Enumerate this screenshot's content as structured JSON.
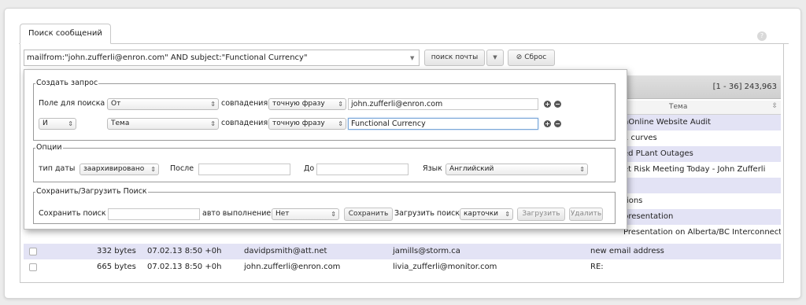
{
  "tab": {
    "label": "Поиск сообщений"
  },
  "search": {
    "query": "mailfrom:\"john.zufferli@enron.com\" AND subject:\"Functional Currency\"",
    "search_label": "поиск почты",
    "reset_label": "Сброс"
  },
  "results": {
    "count": "[1 - 36] 243,963",
    "subject_header": "Тема",
    "subjects_partial": [
      "nOnline Website Audit",
      "1 curves",
      "ed PLant Outages",
      "et Risk Meeting Today - John Zufferli",
      "",
      "tions",
      "presentation",
      "Presentation on Alberta/BC Interconnect"
    ],
    "rows": [
      {
        "size": "332 bytes",
        "date": "07.02.13 8:50 +0h",
        "from": "davidpsmith@att.net",
        "to": "jamills@storm.ca",
        "subject": "new email address"
      },
      {
        "size": "665 bytes",
        "date": "07.02.13 8:50 +0h",
        "from": "john.zufferli@enron.com",
        "to": "livia_zufferli@monitor.com",
        "subject": "RE:"
      }
    ]
  },
  "builder": {
    "create_legend": "Создать запрос",
    "rule1": {
      "field_label": "Поле для поиска",
      "field": "От",
      "match_label": "совпадения",
      "match": "точную фразу",
      "value": "john.zufferli@enron.com"
    },
    "rule2": {
      "op": "И",
      "field": "Тема",
      "match_label": "совпадения",
      "match": "точную фразу",
      "value": "Functional Currency"
    },
    "options_legend": "Опции",
    "date_type_label": "тип даты",
    "date_type": "заархивировано",
    "after_label": "После",
    "before_label": "До",
    "lang_label": "Язык",
    "lang": "Английский",
    "save_legend": "Сохранить/Загрузить Поиск",
    "save_label": "Сохранить поиск",
    "auto_label": "авто выполнение",
    "auto_value": "Нет",
    "save_btn": "Сохранить",
    "load_label": "Загрузить поиск",
    "load_value": "карточки",
    "load_btn": "Загрузить",
    "delete_btn": "Удалить"
  }
}
